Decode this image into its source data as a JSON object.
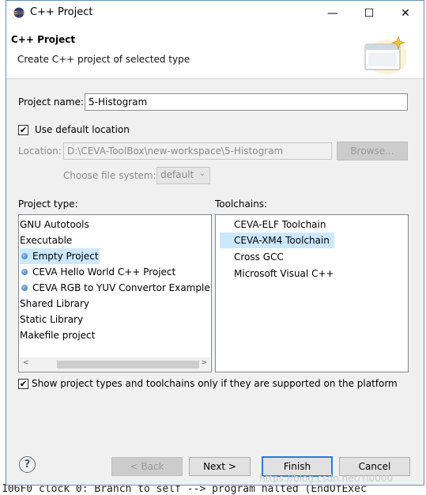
{
  "window": {
    "title": "C++ Project",
    "controls": {
      "minimize": "—",
      "maximize": "☐",
      "close": "✕"
    }
  },
  "banner": {
    "title": "C++ Project",
    "description": "Create C++ project of selected type"
  },
  "project_name": {
    "label": "Project name:",
    "value": "5-Histogram"
  },
  "use_default_location": {
    "label": "Use default location",
    "checked": true
  },
  "location": {
    "label": "Location:",
    "value": "D:\\CEVA-ToolBox\\new-workspace\\5-Histogram",
    "browse_label": "Browse..."
  },
  "file_system": {
    "label": "Choose file system:",
    "value": "default"
  },
  "project_type": {
    "label": "Project type:",
    "items": [
      {
        "label": "GNU Autotools",
        "child": false,
        "selected": false
      },
      {
        "label": "Executable",
        "child": false,
        "selected": false
      },
      {
        "label": "Empty Project",
        "child": true,
        "selected": true
      },
      {
        "label": "CEVA Hello World C++ Project",
        "child": true,
        "selected": false
      },
      {
        "label": "CEVA RGB to YUV Convertor Example",
        "child": true,
        "selected": false
      },
      {
        "label": "Shared Library",
        "child": false,
        "selected": false
      },
      {
        "label": "Static Library",
        "child": false,
        "selected": false
      },
      {
        "label": "Makefile project",
        "child": false,
        "selected": false
      }
    ]
  },
  "toolchains": {
    "label": "Toolchains:",
    "items": [
      {
        "label": "CEVA-ELF Toolchain",
        "selected": false
      },
      {
        "label": "CEVA-XM4 Toolchain",
        "selected": true
      },
      {
        "label": "Cross GCC",
        "selected": false
      },
      {
        "label": "Microsoft Visual C++",
        "selected": false
      }
    ]
  },
  "show_supported": {
    "label": "Show project types and toolchains only if they are supported on the platform",
    "checked": true
  },
  "buttons": {
    "help": "?",
    "back": "< Back",
    "next": "Next >",
    "finish": "Finish",
    "cancel": "Cancel"
  },
  "background": {
    "console_line": "106F0  clock 0: Branch to self --> program halted (EndOfExec",
    "watermark": "https://blog.csdn.net/Yi0000"
  },
  "colors": {
    "selection": "#cce8ff",
    "primary_border": "#2a7cd6",
    "window_border": "#6b8fb3"
  }
}
